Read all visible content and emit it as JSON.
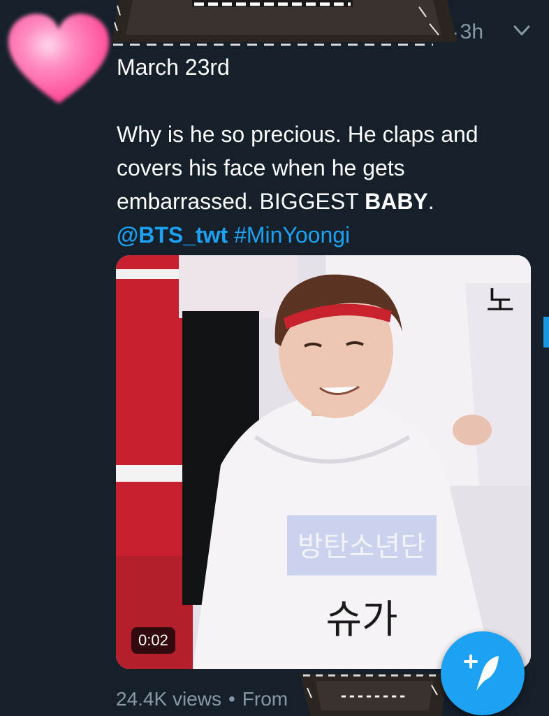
{
  "tweet": {
    "time": "3h",
    "date_line": "March 23rd",
    "body_line1": "Why is he so precious. He claps and",
    "body_line2": "covers his face when he gets",
    "body_line3_prefix": "embarrassed. BIGGEST ",
    "body_line3_bold": "BABY",
    "body_line3_suffix": ".",
    "mention": "@BTS_twt",
    "hashtag": "#MinYoongi"
  },
  "media": {
    "duration": "0:02",
    "shirt_group_text": "방탄소년단",
    "shirt_name_text": "슈가",
    "sign_text": "노"
  },
  "stats": {
    "views": "24.4K views",
    "separator": "•",
    "from": "From"
  },
  "stickers": {
    "top_dashes": "- - - - - - - - - -",
    "bottom_dashes": "--------"
  },
  "icons": {
    "avatar": "pink-heart-icon",
    "menu": "chevron-down-icon",
    "compose": "compose-quill-icon"
  },
  "colors": {
    "background": "#15202b",
    "text": "#ffffff",
    "link": "#1da1f2",
    "muted": "#8899a6",
    "heart": "#ff4f9a"
  }
}
